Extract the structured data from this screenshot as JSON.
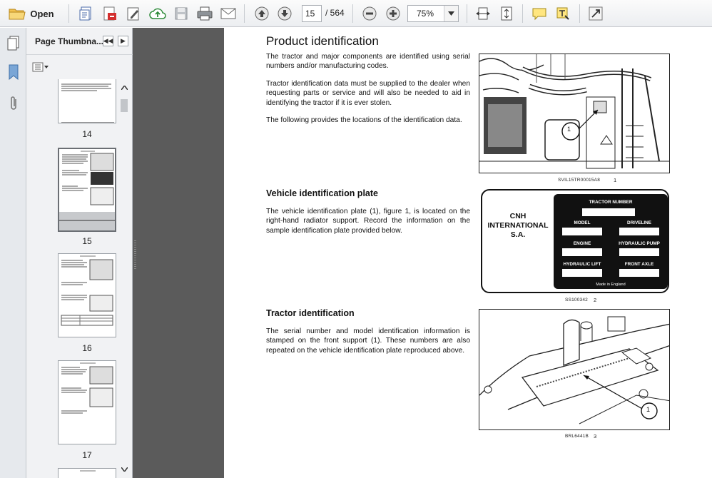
{
  "toolbar": {
    "open_label": "Open",
    "page_current": "15",
    "page_total": "/ 564",
    "zoom": "75%"
  },
  "panel": {
    "title": "Page Thumbna...",
    "thumbs": [
      {
        "label": "14"
      },
      {
        "label": "15"
      },
      {
        "label": "16"
      },
      {
        "label": "17"
      }
    ]
  },
  "doc": {
    "title": "Product identification",
    "intro": [
      "The tractor and major components are identified using serial numbers and/or manufacturing codes.",
      "Tractor identification data must be supplied to the dealer when requesting parts or service and will also be needed to aid in identifying the tractor if it is ever stolen.",
      "The following provides the locations of the identification data."
    ],
    "fig1": {
      "code": "SVIL15TR00015A8",
      "num": "1",
      "callout": "1"
    },
    "section2": {
      "heading": "Vehicle identification plate",
      "text": "The vehicle identification plate (1), figure 1, is located on the right-hand radiator support.  Record the information on the sample identification plate provided below."
    },
    "plate": {
      "company_line1": "CNH",
      "company_line2": "INTERNATIONAL",
      "company_line3": "S.A.",
      "tractor_number": "TRACTOR NUMBER",
      "model": "MODEL",
      "driveline": "DRIVELINE",
      "engine": "ENGINE",
      "hydraulic_pump": "HYDRAULIC PUMP",
      "hydraulic_lift": "HYDRAULIC LIFT",
      "front_axle": "FRONT AXLE",
      "made_in": "Made in England"
    },
    "fig2": {
      "code": "SS100342",
      "num": "2"
    },
    "section3": {
      "heading": "Tractor identification",
      "text": "The serial number and model identification information is stamped on the front support (1).  These numbers are also repeated on the vehicle identification plate reproduced above."
    },
    "fig3": {
      "code": "BRL6441B",
      "num": "3",
      "callout": "1"
    }
  }
}
